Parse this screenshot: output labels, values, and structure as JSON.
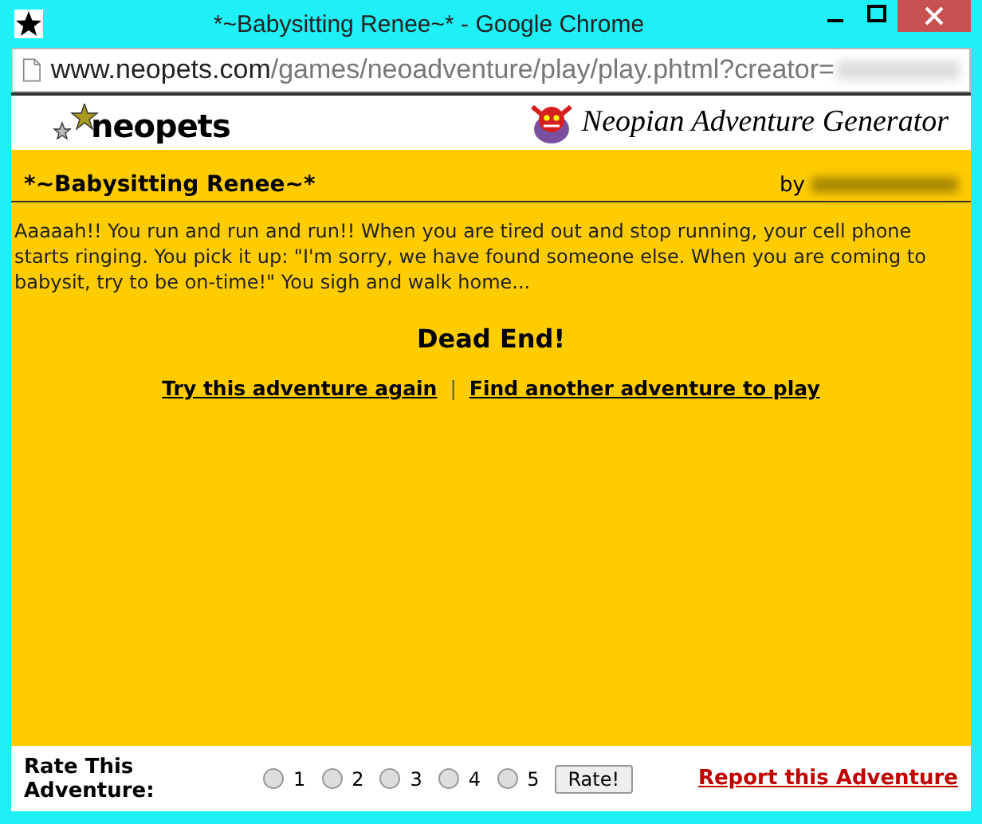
{
  "window": {
    "title": "*~Babysitting Renee~* - Google Chrome"
  },
  "address_bar": {
    "host": "www.neopets.com",
    "path": "/games/neoadventure/play/play.phtml?creator="
  },
  "header": {
    "logo": "neopets",
    "banner": "Neopian Adventure Generator"
  },
  "adventure": {
    "title": "*~Babysitting Renee~*",
    "by": "by",
    "story": "Aaaaah!! You run and run and run!! When you are tired out and stop running, your cell phone starts ringing. You pick it up: \"I'm sorry, we have found someone else. When you are coming to babysit, try to be on-time!\" You sigh and walk home...",
    "result": "Dead End!",
    "links": [
      "Try this adventure again",
      "Find another adventure to play"
    ],
    "separator": "|"
  },
  "rating": {
    "label": "Rate This Adventure:",
    "options": [
      {
        "label": "1",
        "selected": false
      },
      {
        "label": "2",
        "selected": false
      },
      {
        "label": "3",
        "selected": false
      },
      {
        "label": "4",
        "selected": false
      },
      {
        "label": "5",
        "selected": false
      }
    ],
    "button": "Rate!",
    "report": "Report this Adventure"
  }
}
